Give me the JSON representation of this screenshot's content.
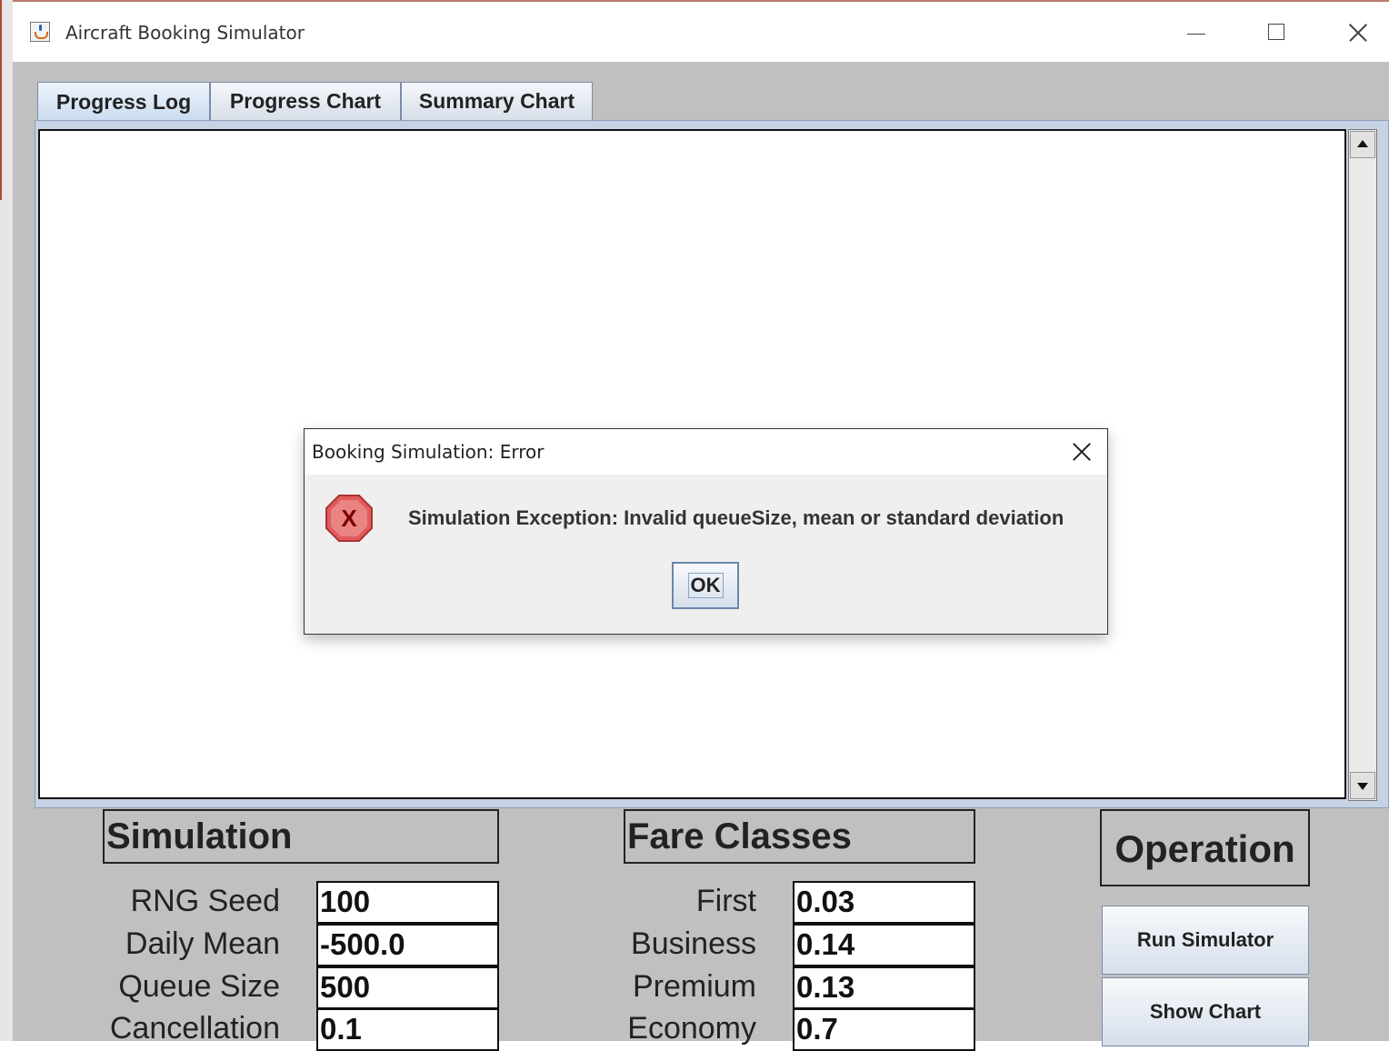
{
  "window": {
    "title": "Aircraft Booking Simulator"
  },
  "tabs": [
    {
      "label": "Progress Log",
      "active": true
    },
    {
      "label": "Progress Chart",
      "active": false
    },
    {
      "label": "Summary Chart",
      "active": false
    }
  ],
  "simulation": {
    "heading": "Simulation",
    "fields": [
      {
        "label": "RNG Seed",
        "value": "100"
      },
      {
        "label": "Daily Mean",
        "value": "-500.0"
      },
      {
        "label": "Queue Size",
        "value": "500"
      },
      {
        "label": "Cancellation",
        "value": "0.1"
      }
    ]
  },
  "fare_classes": {
    "heading": "Fare Classes",
    "fields": [
      {
        "label": "First",
        "value": "0.03"
      },
      {
        "label": "Business",
        "value": "0.14"
      },
      {
        "label": "Premium",
        "value": "0.13"
      },
      {
        "label": "Economy",
        "value": "0.7"
      }
    ]
  },
  "operation": {
    "heading": "Operation",
    "run_label": "Run Simulator",
    "chart_label": "Show Chart"
  },
  "dialog": {
    "title": "Booking Simulation: Error",
    "message": "Simulation Exception:  Invalid queueSize, mean or standard deviation",
    "ok_label": "OK",
    "icon_glyph": "X",
    "icon": "error-icon"
  },
  "colors": {
    "window_bg": "#c0c0c0",
    "tab_accent": "#c9dbef",
    "error_red": "#d9534f"
  }
}
